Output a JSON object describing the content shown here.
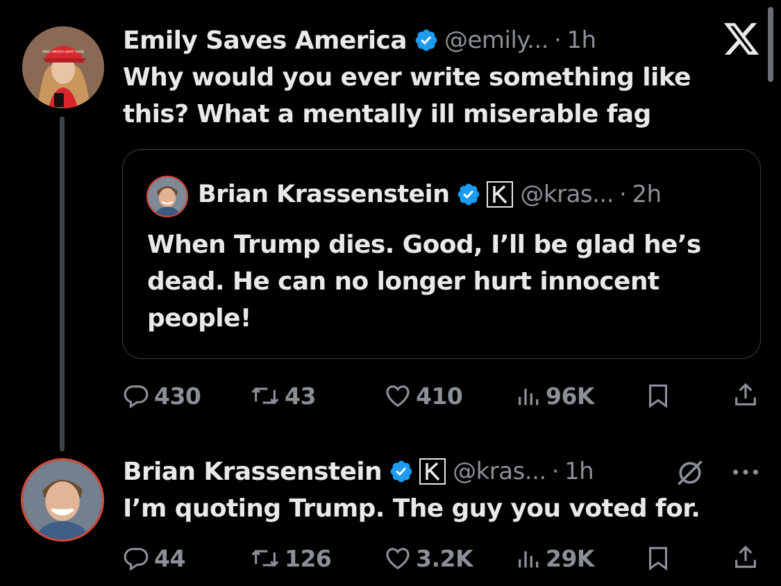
{
  "reply": {
    "name": "Emily Saves America",
    "handle": "@emily...",
    "sep": "·",
    "time": "1h",
    "text_line1": "Why would you ever write something like",
    "text_line2": "this? What a mentally ill miserable fag",
    "avatar_hat_text": "MAKE AMERICA GREAT AGAIN"
  },
  "quoted": {
    "name": "Brian Krassenstein",
    "handle": "@kras...",
    "sep": "·",
    "time": "2h",
    "text_line1": "When Trump dies. Good, I’ll be glad he’s",
    "text_line2": "dead. He can no longer hurt innocent",
    "text_line3": "people!"
  },
  "reply_stats": {
    "replies": "430",
    "reposts": "43",
    "likes": "410",
    "views": "96K"
  },
  "response": {
    "name": "Brian Krassenstein",
    "handle": "@kras...",
    "sep": "·",
    "time": "1h",
    "text": "I’m quoting Trump. The guy you voted for."
  },
  "response_stats": {
    "replies": "44",
    "reposts": "126",
    "likes": "3.2K",
    "views": "29K"
  },
  "icons": {
    "verified": "verified-badge-icon",
    "affiliate": "k-affiliate-icon",
    "reply": "reply-icon",
    "repost": "repost-icon",
    "like": "heart-icon",
    "views": "views-icon",
    "bookmark": "bookmark-icon",
    "share": "share-icon",
    "brand": "x-logo-icon",
    "grok": "grok-icon",
    "more": "more-icon"
  },
  "colors": {
    "background": "#000000",
    "text": "#e7e9ea",
    "muted": "#8b9096",
    "verified": "#1d9bf0"
  }
}
